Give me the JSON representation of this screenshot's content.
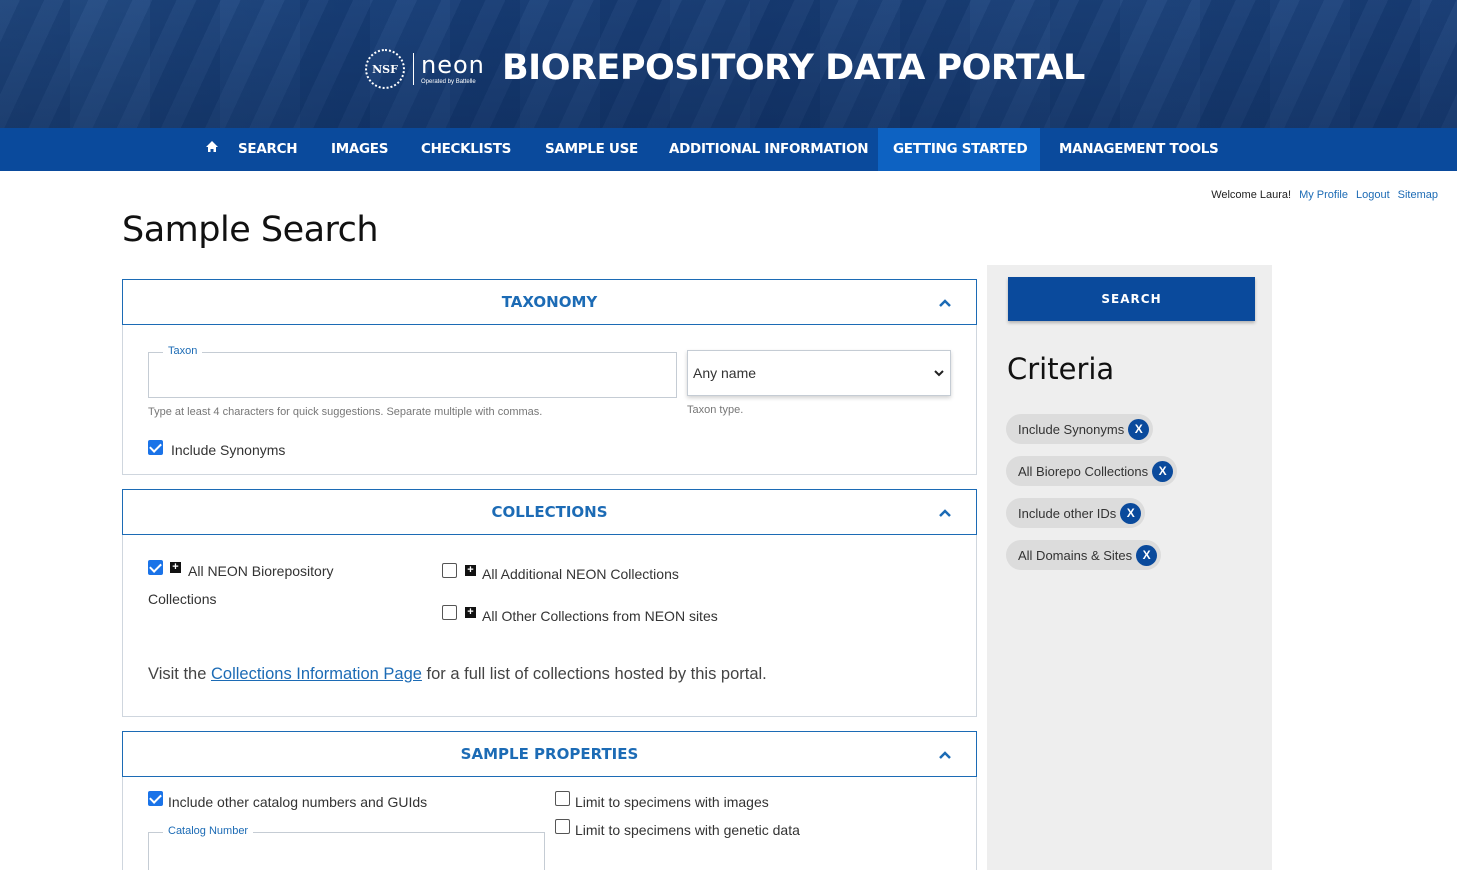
{
  "header": {
    "nsf_seal_text": "NSF",
    "neon_logo_text": "neon",
    "neon_operated_text": "Operated by Battelle",
    "portal_title": "BIOREPOSITORY DATA PORTAL"
  },
  "nav": {
    "items": [
      "SEARCH",
      "IMAGES",
      "CHECKLISTS",
      "SAMPLE USE",
      "ADDITIONAL INFORMATION",
      "GETTING STARTED",
      "MANAGEMENT TOOLS"
    ],
    "active": "GETTING STARTED"
  },
  "userbar": {
    "welcome": "Welcome Laura!",
    "links": [
      "My Profile",
      "Logout",
      "Sitemap"
    ]
  },
  "page_title": "Sample Search",
  "taxonomy": {
    "header": "TAXONOMY",
    "taxon_legend": "Taxon",
    "taxon_value": "",
    "taxon_hint": "Type at least 4 characters for quick suggestions. Separate multiple with commas.",
    "taxon_type_selected": "Any name",
    "taxon_type_hint": "Taxon type.",
    "include_synonyms_label": "Include Synonyms",
    "include_synonyms_checked": true
  },
  "collections": {
    "header": "COLLECTIONS",
    "neon_biorepo_label_line1": "All NEON Biorepository",
    "neon_biorepo_label_line2": "Collections",
    "neon_biorepo_checked": true,
    "additional_label": "All Additional NEON Collections",
    "additional_checked": false,
    "other_label": "All Other Collections from NEON sites",
    "other_checked": false,
    "info_prefix": "Visit the ",
    "info_link": "Collections Information Page",
    "info_suffix": " for a full list of collections hosted by this portal."
  },
  "sample_properties": {
    "header": "SAMPLE PROPERTIES",
    "other_catalog_label": "Include other catalog numbers and GUIds",
    "other_catalog_checked": true,
    "with_images_label": "Limit to specimens with images",
    "with_images_checked": false,
    "genetic_label": "Limit to specimens with genetic data",
    "genetic_checked": false,
    "catalog_legend": "Catalog Number",
    "catalog_value": ""
  },
  "sidebar": {
    "search_button": "SEARCH",
    "criteria_title": "Criteria",
    "chips": [
      "Include Synonyms",
      "All Biorepo Collections",
      "Include other IDs",
      "All Domains & Sites"
    ],
    "chip_remove_label": "X"
  },
  "colors": {
    "nav_bg": "#0a4a9c",
    "nav_active": "#0d62c2",
    "accent": "#1c6bb5",
    "checkbox": "#1a73e8"
  }
}
